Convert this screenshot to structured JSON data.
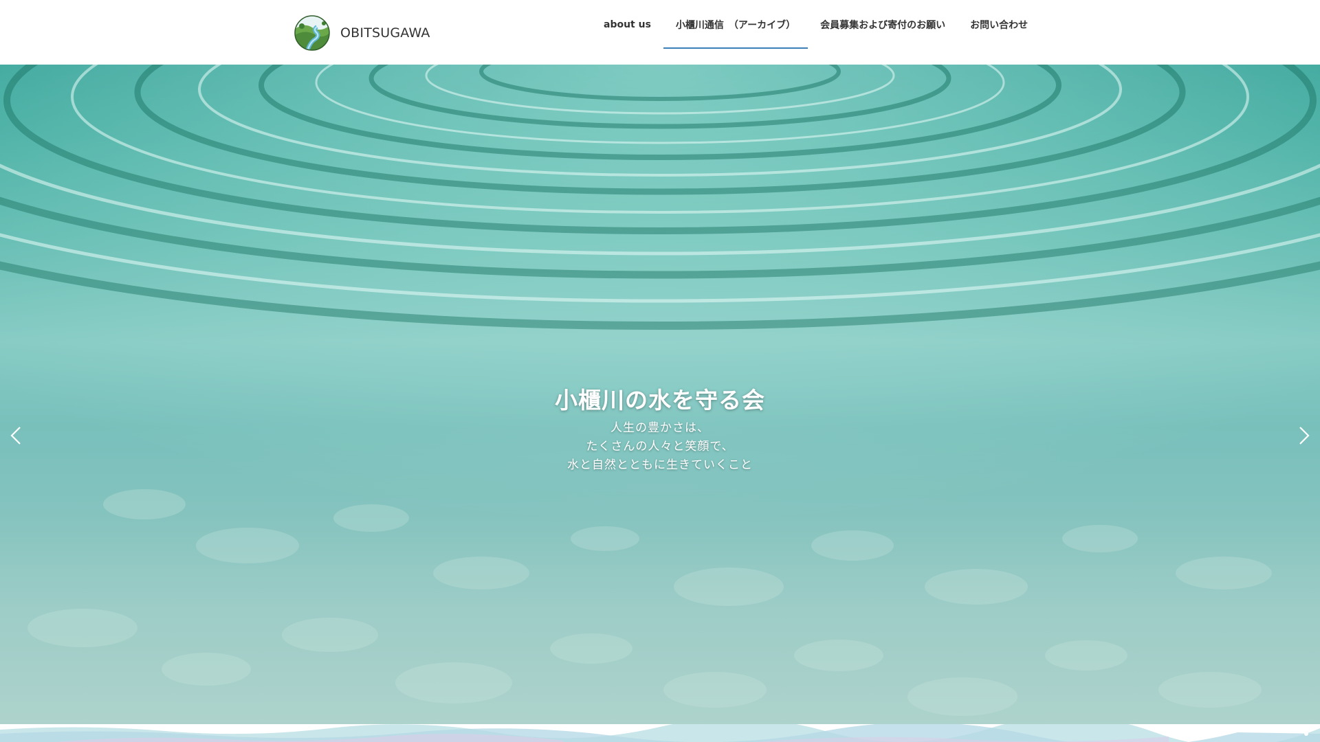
{
  "brand": {
    "name": "OBITSUGAWA",
    "logo_icon": "river-landscape-logo-icon"
  },
  "nav": {
    "items": [
      {
        "label": "about us",
        "active": false
      },
      {
        "label": "小櫃川通信　（アーカイブ）",
        "active": true
      },
      {
        "label": "会員募集および寄付のお願い",
        "active": false
      },
      {
        "label": "お問い合わせ",
        "active": false
      }
    ]
  },
  "hero": {
    "title": "小櫃川の水を守る会",
    "lines": [
      "人生の豊かさは、",
      "たくさんの人々と笑顔で、",
      "水と自然とともに生きていくこと"
    ],
    "prev_icon": "chevron-left-icon",
    "next_icon": "chevron-right-icon"
  },
  "colors": {
    "nav_active_underline": "#3a7fb8",
    "text_dark": "#333333",
    "hero_text": "#ffffff"
  }
}
